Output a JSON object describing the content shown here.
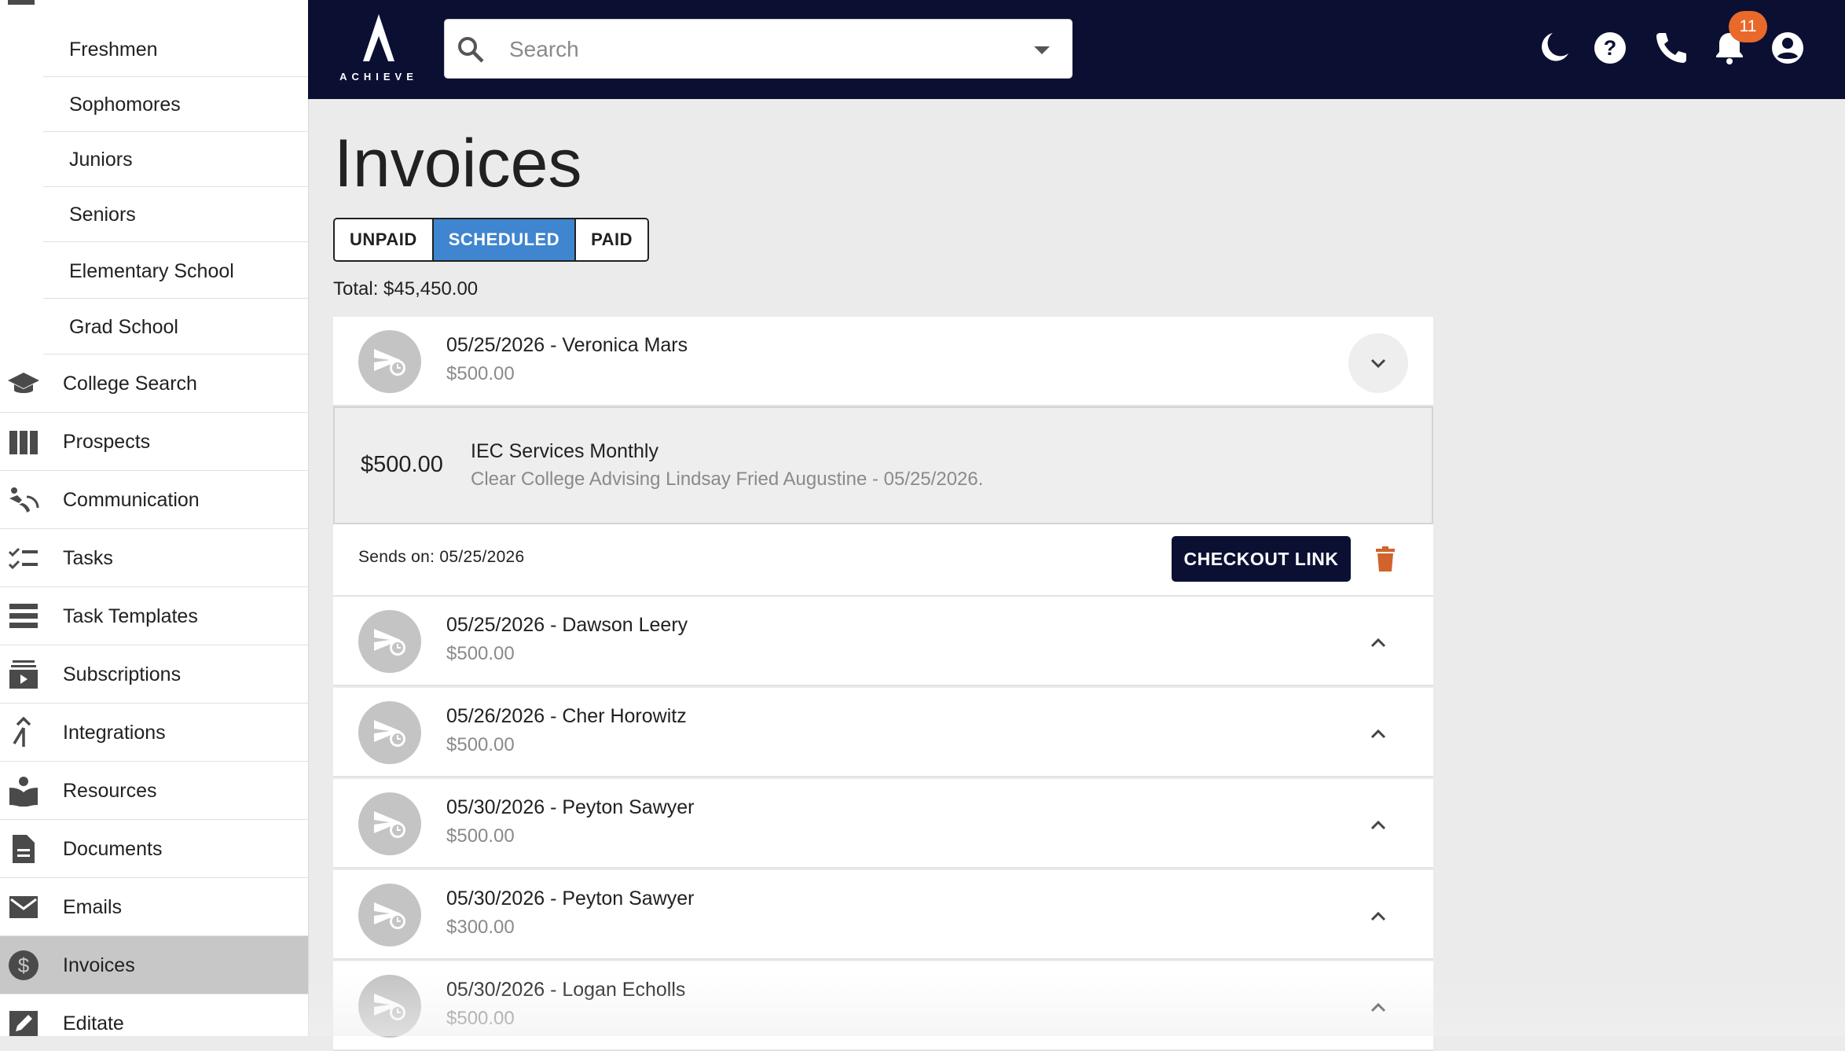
{
  "sidebar": {
    "sub_items": [
      {
        "label": "Freshmen"
      },
      {
        "label": "Sophomores"
      },
      {
        "label": "Juniors"
      },
      {
        "label": "Seniors"
      },
      {
        "label": "Elementary School"
      },
      {
        "label": "Grad School"
      }
    ],
    "items": [
      {
        "label": "College Search",
        "icon": "graduation-cap-icon"
      },
      {
        "label": "Prospects",
        "icon": "columns-icon"
      },
      {
        "label": "Communication",
        "icon": "communication-icon"
      },
      {
        "label": "Tasks",
        "icon": "checklist-icon"
      },
      {
        "label": "Task Templates",
        "icon": "list-icon"
      },
      {
        "label": "Subscriptions",
        "icon": "subscriptions-icon"
      },
      {
        "label": "Integrations",
        "icon": "merge-icon"
      },
      {
        "label": "Resources",
        "icon": "book-icon"
      },
      {
        "label": "Documents",
        "icon": "document-icon"
      },
      {
        "label": "Emails",
        "icon": "mail-icon"
      },
      {
        "label": "Invoices",
        "icon": "dollar-icon",
        "active": true
      },
      {
        "label": "Editate",
        "icon": "edit-icon"
      }
    ]
  },
  "header": {
    "logo_text": "ACHIEVE",
    "search_placeholder": "Search",
    "notification_count": "11",
    "bg_color": "#0b1033"
  },
  "main": {
    "title": "Invoices",
    "tabs": [
      {
        "label": "UNPAID",
        "selected": false
      },
      {
        "label": "SCHEDULED",
        "selected": true
      },
      {
        "label": "PAID",
        "selected": false
      }
    ],
    "total": "Total: $45,450.00",
    "invoices": [
      {
        "title": "05/25/2026 - Veronica Mars",
        "amount": "$500.00",
        "expanded": true
      },
      {
        "title": "05/25/2026 - Dawson Leery",
        "amount": "$500.00"
      },
      {
        "title": "05/26/2026 - Cher Horowitz",
        "amount": "$500.00"
      },
      {
        "title": "05/30/2026 - Peyton Sawyer",
        "amount": "$500.00"
      },
      {
        "title": "05/30/2026 - Peyton Sawyer",
        "amount": "$300.00"
      },
      {
        "title": "05/30/2026 - Logan Echolls",
        "amount": "$500.00"
      }
    ],
    "expanded_detail": {
      "amount": "$500.00",
      "name": "IEC Services Monthly",
      "description": "Clear College Advising Lindsay Fried Augustine - 05/25/2026.",
      "sends_on": "Sends on: 05/25/2026",
      "checkout_label": "CHECKOUT LINK"
    }
  },
  "colors": {
    "accent": "#3f85cf",
    "navy": "#0b1033",
    "delete": "#d0642c",
    "badge": "#e8692a"
  }
}
